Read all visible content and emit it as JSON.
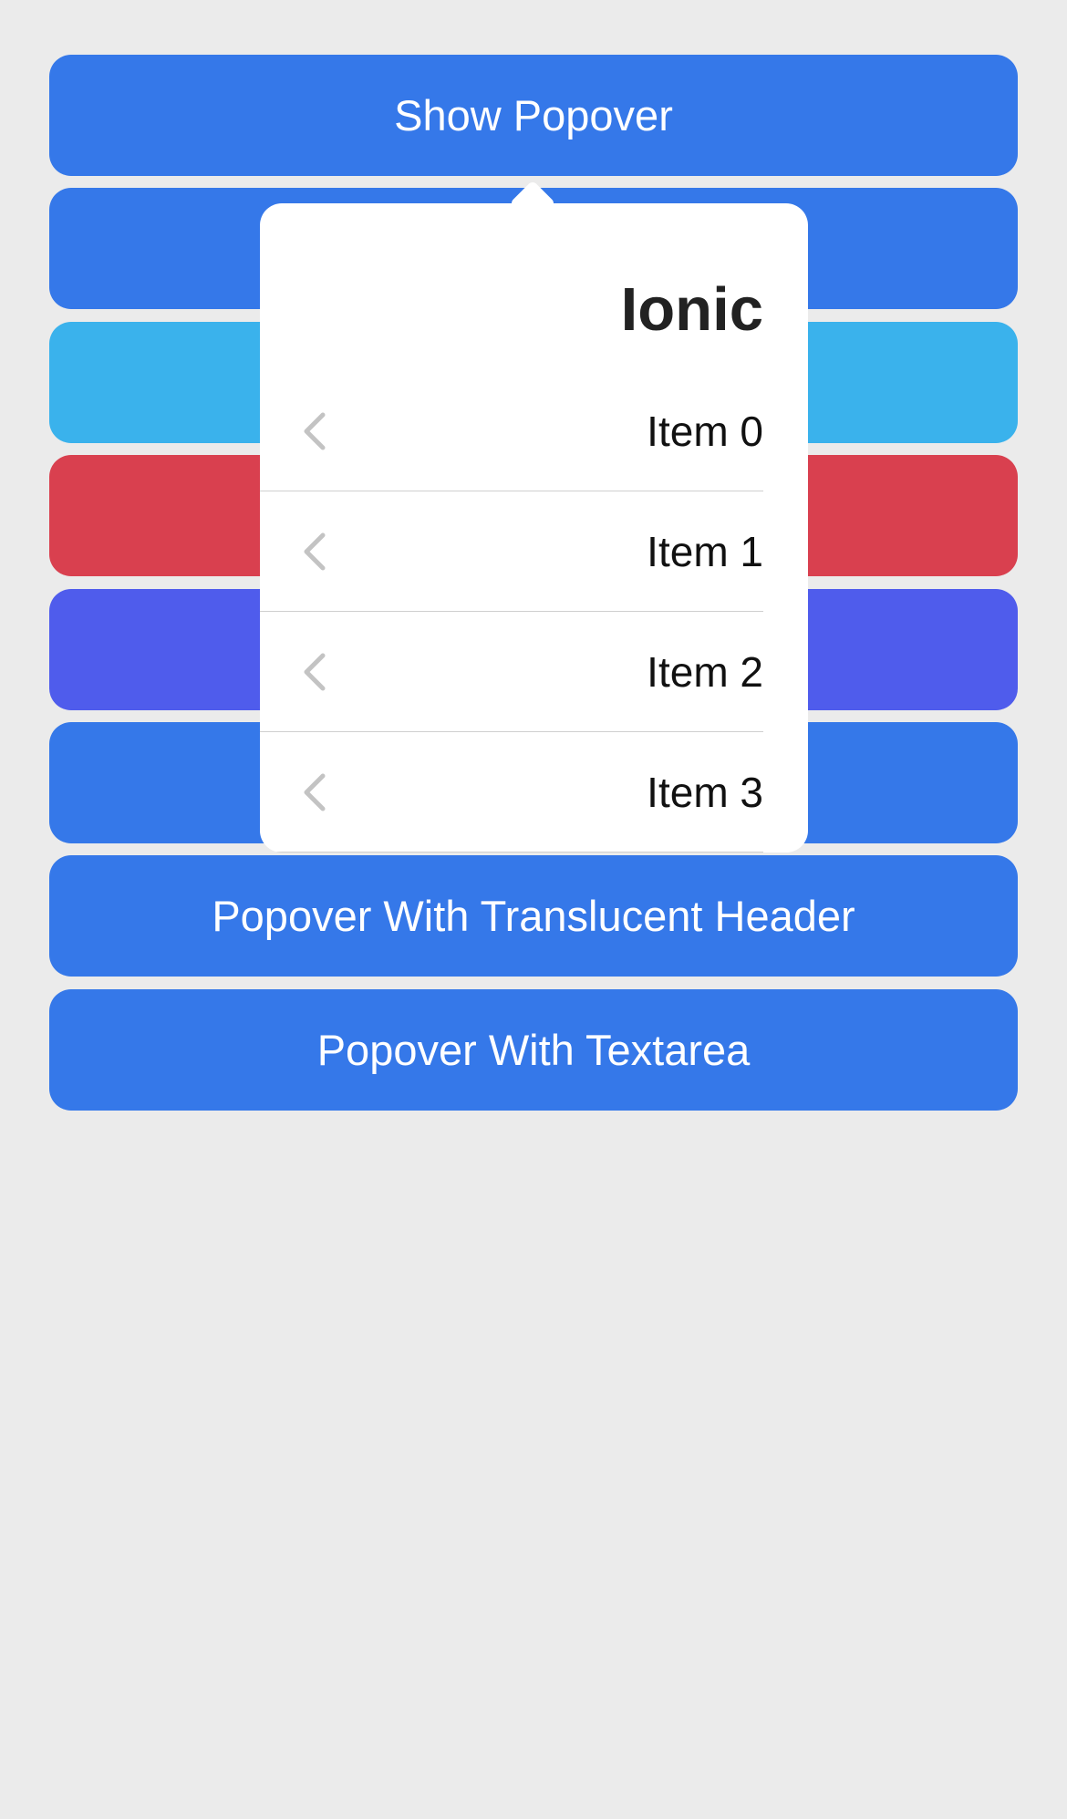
{
  "colors": {
    "background": "#ebebeb",
    "primary": "#3578e9",
    "secondary": "#3ab2ec",
    "danger": "#d9404f",
    "tertiary": "#4f5cec",
    "popover": "#ffffff"
  },
  "buttons": [
    {
      "label": "Show Popover",
      "color": "#3578e9"
    },
    {
      "label": "",
      "color": "#3578e9"
    },
    {
      "label": "",
      "color": "#3ab2ec"
    },
    {
      "label": "",
      "color": "#d9404f"
    },
    {
      "label": "",
      "color": "#4f5cec"
    },
    {
      "label": "",
      "color": "#3578e9"
    },
    {
      "label": "Popover With Translucent Header",
      "color": "#3578e9"
    },
    {
      "label": "Popover With Textarea",
      "color": "#3578e9"
    }
  ],
  "popover": {
    "title": "Ionic",
    "items": [
      {
        "label": "Item 0",
        "icon": "chevron-back-icon"
      },
      {
        "label": "Item 1",
        "icon": "chevron-back-icon"
      },
      {
        "label": "Item 2",
        "icon": "chevron-back-icon"
      },
      {
        "label": "Item 3",
        "icon": "chevron-back-icon"
      }
    ]
  }
}
